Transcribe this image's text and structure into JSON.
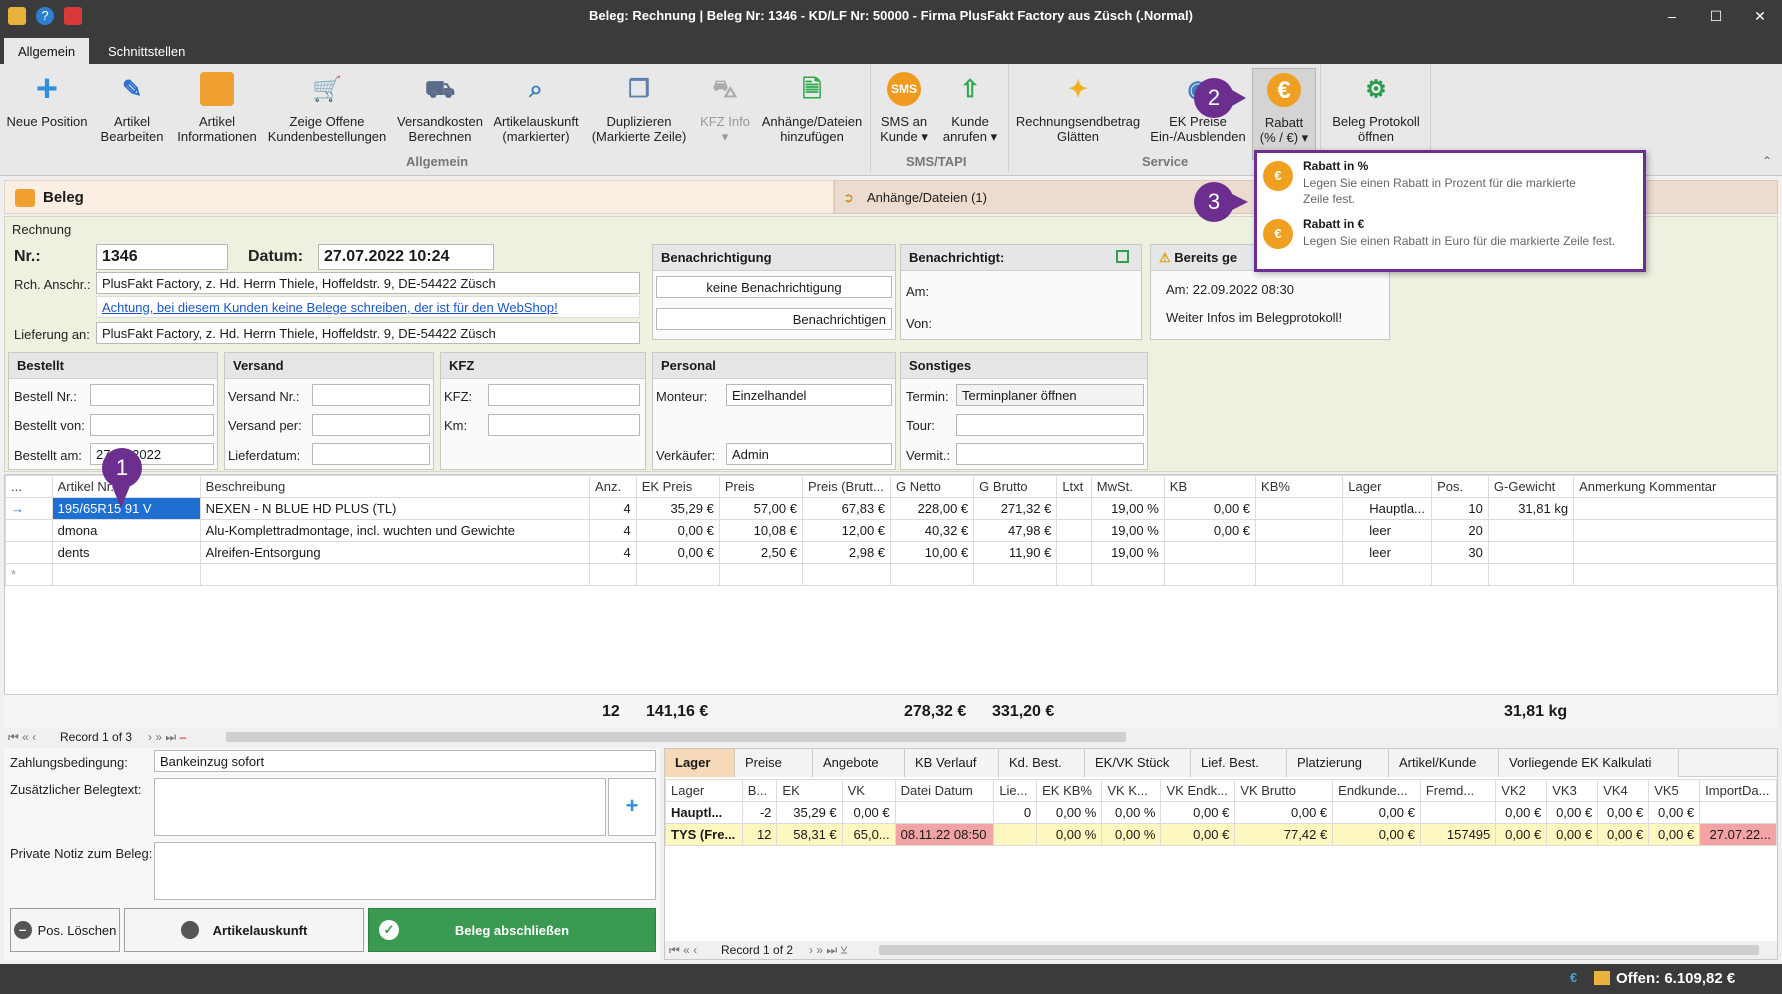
{
  "window": {
    "title": "Beleg: Rechnung | Beleg Nr: 1346 -  KD/LF Nr: 50000 - Firma PlusFakt Factory  aus Züsch (.Normal)"
  },
  "tabs": [
    "Allgemein",
    "Schnittstellen"
  ],
  "ribbon": {
    "neue_position": "Neue Position",
    "artikel_bearbeiten_1": "Artikel",
    "artikel_bearbeiten_2": "Bearbeiten",
    "artikel_info_1": "Artikel",
    "artikel_info_2": "Informationen",
    "offene_1": "Zeige Offene",
    "offene_2": "Kundenbestellungen",
    "versand_1": "Versandkosten",
    "versand_2": "Berechnen",
    "auskunft_1": "Artikelauskunft",
    "auskunft_2": "(markierter)",
    "dup_1": "Duplizieren",
    "dup_2": "(Markierte Zeile)",
    "kfz_1": "KFZ Info",
    "kfz_2": "▾",
    "anh_1": "Anhänge/Dateien",
    "anh_2": "hinzufügen",
    "sms_1": "SMS an",
    "sms_2": "Kunde ▾",
    "anruf_1": "Kunde",
    "anruf_2": "anrufen ▾",
    "glatt_1": "Rechnungsendbetrag",
    "glatt_2": "Glätten",
    "ek_1": "EK Preise",
    "ek_2": "Ein-/Ausblenden",
    "rabatt_1": "Rabatt",
    "rabatt_2": "(% / €) ▾",
    "proto_1": "Beleg Protokoll",
    "proto_2": "öffnen",
    "group_allgemein": "Allgemein",
    "group_sms": "SMS/TAPI",
    "group_service": "Service"
  },
  "callouts": {
    "one": "1",
    "two": "2",
    "three": "3"
  },
  "rabatt_menu": {
    "item1_title": "Rabatt in %",
    "item1_desc": "Legen Sie einen Rabatt in Prozent für die markierte Zeile fest.",
    "item2_title": "Rabatt in €",
    "item2_desc": "Legen Sie einen Rabatt in Euro für die markierte Zeile fest."
  },
  "beleg": {
    "header": "Beleg",
    "anhaenge_tab": "Anhänge/Dateien (1)",
    "section": "Rechnung",
    "nr_label": "Nr.:",
    "nr": "1346",
    "datum_label": "Datum:",
    "datum": "27.07.2022 10:24",
    "rch_label": "Rch. Anschr.:",
    "rch": "PlusFakt Factory, z. Hd. Herrn Thiele, Hoffeldstr. 9,  DE-54422 Züsch",
    "warn": "Achtung, bei diesem Kunden keine Belege schreiben, der ist für den WebShop!",
    "lief_label": "Lieferung an:",
    "lief": "PlusFakt Factory, z. Hd. Herrn Thiele, Hoffeldstr. 9,  DE-54422 Züsch",
    "benach_head": "Benachrichtigung",
    "benach_val": "keine Benachrichtigung",
    "benach_btn": "Benachrichtigen",
    "benachrichtigt_head": "Benachrichtigt:",
    "am": "Am:",
    "von": "Von:",
    "bereits_head": "Bereits ge",
    "bereits_am": "Am:  22.09.2022 08:30",
    "bereits_info": "Weiter Infos im Belegprotokoll!",
    "bestellt_head": "Bestellt",
    "bestellt_nr": "Bestell Nr.:",
    "bestellt_von": "Bestellt von:",
    "bestellt_am": "Bestellt am:",
    "bestellt_am_val": "27.07.2022",
    "versand_head": "Versand",
    "versand_nr": "Versand Nr.:",
    "versand_per": "Versand per:",
    "lieferdatum": "Lieferdatum:",
    "kfz_head": "KFZ",
    "kfz": "KFZ:",
    "km": "Km:",
    "personal_head": "Personal",
    "monteur": "Monteur:",
    "monteur_val": "Einzelhandel",
    "verkaeufer": "Verkäufer:",
    "verkaeufer_val": "Admin",
    "sonst_head": "Sonstiges",
    "termin": "Termin:",
    "termin_val": "Terminplaner öffnen",
    "tour": "Tour:",
    "vermit": "Vermit.:"
  },
  "positions": {
    "headers": [
      "...",
      "Artikel Nr.",
      "Beschreibung",
      "Anz.",
      "EK Preis",
      "Preis",
      "Preis (Brutt...",
      "G Netto",
      "G Brutto",
      "Ltxt",
      "MwSt.",
      "KB",
      "KB%",
      "Lager",
      "Pos.",
      "G-Gewicht",
      "Anmerkung Kommentar"
    ],
    "rows": [
      {
        "art": "195/65R15 91 V",
        "desc": "NEXEN - N BLUE HD PLUS (TL)",
        "anz": "4",
        "ek": "35,29 €",
        "preis": "57,00 €",
        "brutt": "67,83 €",
        "gn": "228,00 €",
        "gb": "271,32 €",
        "mwst": "19,00 %",
        "kb": "0,00 €",
        "lager": "Hauptla...",
        "pos": "10",
        "gew": "31,81 kg"
      },
      {
        "art": "dmona",
        "desc": "Alu-Komplettradmontage, incl. wuchten und Gewichte",
        "anz": "4",
        "ek": "0,00 €",
        "preis": "10,08 €",
        "brutt": "12,00 €",
        "gn": "40,32 €",
        "gb": "47,98 €",
        "mwst": "19,00 %",
        "kb": "0,00 €",
        "lager": "leer",
        "pos": "20",
        "gew": ""
      },
      {
        "art": "dents",
        "desc": "Alreifen-Entsorgung",
        "anz": "4",
        "ek": "0,00 €",
        "preis": "2,50 €",
        "brutt": "2,98 €",
        "gn": "10,00 €",
        "gb": "11,90 €",
        "mwst": "19,00 %",
        "kb": "",
        "lager": "leer",
        "pos": "30",
        "gew": ""
      }
    ],
    "totals": {
      "anz": "12",
      "ek": "141,16 €",
      "gn": "278,32 €",
      "gb": "331,20 €",
      "gew": "31,81 kg"
    },
    "record": "Record 1 of 3"
  },
  "bottom": {
    "zahlung_label": "Zahlungsbedingung:",
    "zahlung": "Bankeinzug sofort",
    "zusatz_label": "Zusätzlicher Belegtext:",
    "notiz_label": "Private Notiz zum Beleg:",
    "btn_loeschen": "Pos. Löschen",
    "btn_auskunft": "Artikelauskunft",
    "btn_abschliessen": "Beleg abschließen"
  },
  "lager": {
    "tabs": [
      "Lager",
      "Preise",
      "Angebote",
      "KB Verlauf",
      "Kd. Best.",
      "EK/VK Stück",
      "Lief. Best.",
      "Platzierung",
      "Artikel/Kunde",
      "Vorliegende EK Kalkulati"
    ],
    "headers": [
      "Lager",
      "B...",
      "EK",
      "VK",
      "Datei Datum",
      "Lie...",
      "EK KB%",
      "VK K...",
      "VK Endk...",
      "VK Brutto",
      "Endkunde...",
      "Fremd...",
      "VK2",
      "VK3",
      "VK4",
      "VK5",
      "ImportDa..."
    ],
    "rows": [
      [
        "Hauptl...",
        "-2",
        "35,29 €",
        "0,00 €",
        "",
        "0",
        "0,00 %",
        "0,00 %",
        "0,00 €",
        "0,00 €",
        "0,00 €",
        "",
        "0,00 €",
        "0,00 €",
        "0,00 €",
        "0,00 €",
        ""
      ],
      [
        "TYS (Fre...",
        "12",
        "58,31 €",
        "65,0...",
        "08.11.22 08:50",
        "",
        "0,00 %",
        "0,00 %",
        "0,00 €",
        "77,42 €",
        "0,00 €",
        "157495",
        "0,00 €",
        "0,00 €",
        "0,00 €",
        "0,00 €",
        "27.07.22..."
      ]
    ],
    "record": "Record 1 of 2"
  },
  "status": {
    "offen": "Offen: 6.109,82 €"
  },
  "colors": {
    "accent": "#6d2f8f",
    "green": "#3a9a52",
    "titlebar": "#3b3b3b",
    "highlight": "#fff7c0",
    "redcell": "#f2a3a3"
  }
}
